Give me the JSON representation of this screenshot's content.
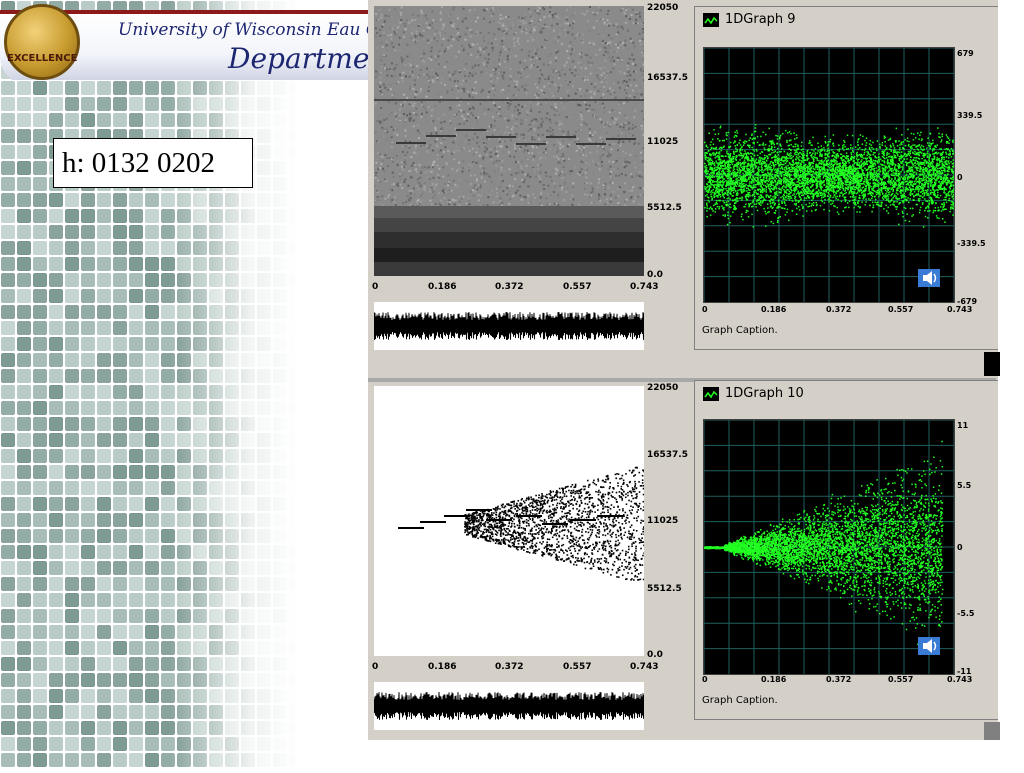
{
  "slide": {
    "banner": {
      "university": "University of Wisconsin Eau Cl",
      "department": "Departmen",
      "seal_text": "EXCELLENCE"
    },
    "label_box": "h: 0132 0202"
  },
  "panels": {
    "top": {
      "spectrogram_y_ticks": [
        "22050",
        "16537.5",
        "11025",
        "5512.5",
        "0.0"
      ],
      "x_ticks": [
        "0",
        "0.186",
        "0.372",
        "0.557",
        "0.743"
      ],
      "graph": {
        "title": "1DGraph  9",
        "y_ticks": [
          "679",
          "339.5",
          "0",
          "-339.5",
          "-679"
        ],
        "x_ticks": [
          "0",
          "0.186",
          "0.372",
          "0.557",
          "0.743"
        ],
        "caption": "Graph Caption."
      }
    },
    "bottom": {
      "spectrogram_y_ticks": [
        "22050",
        "16537.5",
        "11025",
        "5512.5",
        "0.0"
      ],
      "x_ticks": [
        "0",
        "0.186",
        "0.372",
        "0.557",
        "0.743"
      ],
      "graph": {
        "title": "1DGraph  10",
        "y_ticks": [
          "11",
          "5.5",
          "0",
          "-5.5",
          "-11"
        ],
        "x_ticks": [
          "0",
          "0.186",
          "0.372",
          "0.557",
          "0.743"
        ],
        "caption": "Graph Caption."
      }
    }
  },
  "colors": {
    "signal": "#22ff22",
    "plot_bg": "#000000",
    "grid": "#1f5f5f",
    "banner_text": "#1d2670",
    "window_face": "#d4d0c8"
  },
  "icons": [
    "graph-window-icon",
    "speaker-icon",
    "university-seal"
  ]
}
